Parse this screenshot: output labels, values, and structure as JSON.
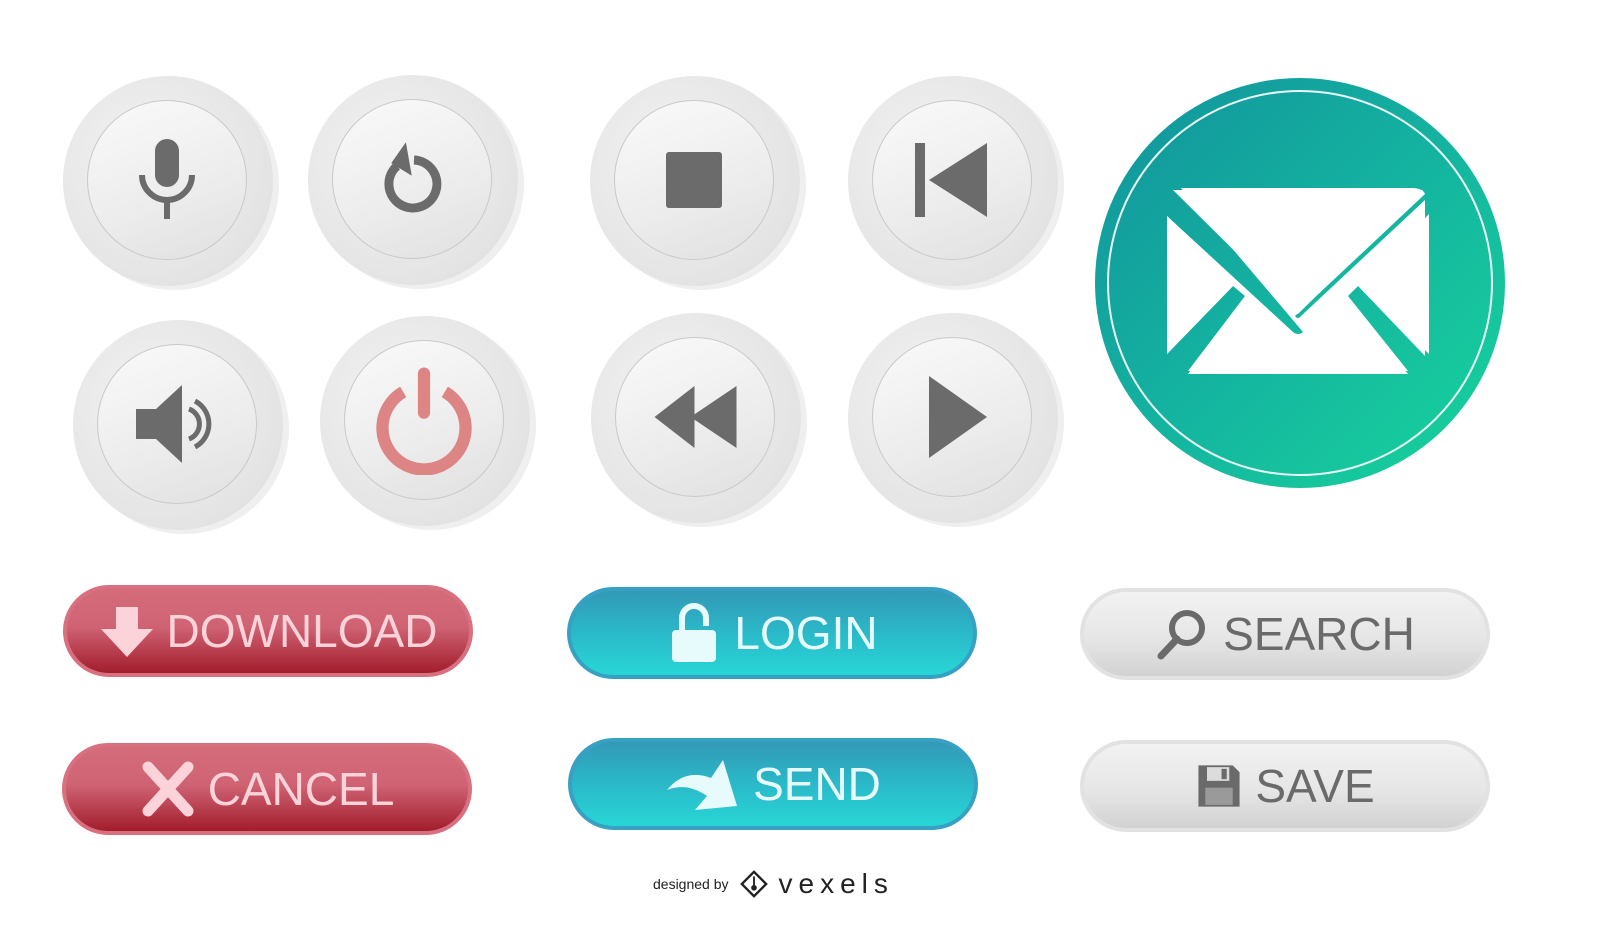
{
  "round_buttons": [
    {
      "icon": "microphone-icon"
    },
    {
      "icon": "refresh-icon"
    },
    {
      "icon": "stop-icon"
    },
    {
      "icon": "skip-back-icon"
    },
    {
      "icon": "speaker-icon"
    },
    {
      "icon": "power-icon"
    },
    {
      "icon": "rewind-icon"
    },
    {
      "icon": "play-icon"
    }
  ],
  "mail_button": {
    "icon": "envelope-icon"
  },
  "pill_buttons": {
    "download": "DOWNLOAD",
    "cancel": "CANCEL",
    "login": "LOGIN",
    "send": "SEND",
    "search": "SEARCH",
    "save": "SAVE"
  },
  "credit": {
    "designed_by": "designed by",
    "brand": "vexels"
  },
  "colors": {
    "icon_gray": "#6b6b6b",
    "power_red": "#dd8585",
    "red": "#cf6374",
    "blue": "#2ab9c9",
    "teal": "#14b3a0",
    "gray": "#e6e6e6"
  }
}
